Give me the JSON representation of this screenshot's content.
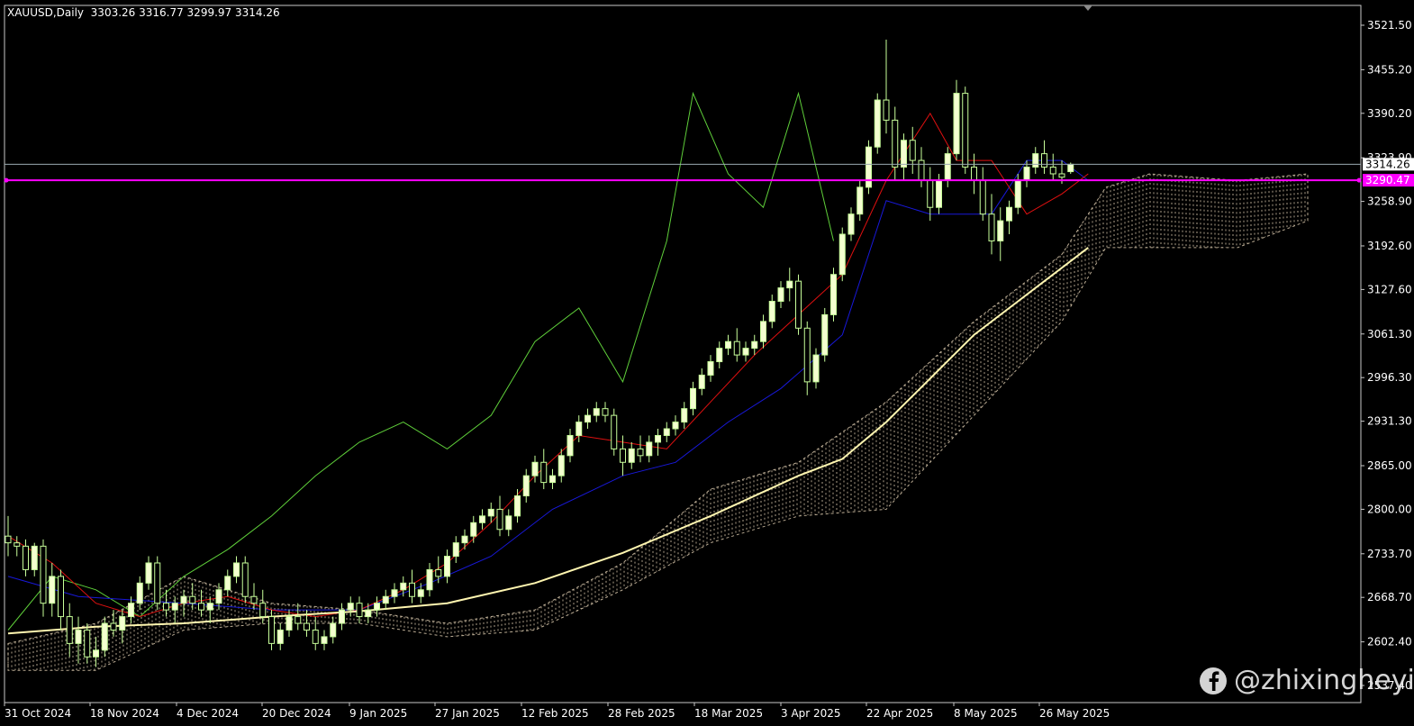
{
  "header": {
    "symbol_timeframe": "XAUUSD,Daily",
    "ohlc": "3303.26 3316.77 3299.97 3314.26"
  },
  "price_labels": {
    "current": "3314.26",
    "horizontal_line": "3290.47"
  },
  "watermark": {
    "icon": "facebook-icon",
    "text": "@zhixingheyi"
  },
  "colors": {
    "background": "#000000",
    "bull_body": "#f4ffd0",
    "wick": "#c8ff9a",
    "tenkan": "#e01010",
    "kijun": "#1818d8",
    "chikou": "#5fcf3a",
    "ma": "#fff6b0",
    "cloud": "#e8d6b8",
    "hline": "#ff00ff"
  },
  "chart_data": {
    "type": "candlestick",
    "symbol": "XAUUSD",
    "timeframe": "Daily",
    "y_ticks": [
      3521.5,
      3455.2,
      3390.2,
      3323.9,
      3258.9,
      3192.6,
      3127.6,
      3061.3,
      2996.3,
      2931.3,
      2865.0,
      2800.0,
      2733.7,
      2668.7,
      2602.4,
      2537.4
    ],
    "x_ticks": [
      "31 Oct 2024",
      "18 Nov 2024",
      "4 Dec 2024",
      "20 Dec 2024",
      "9 Jan 2025",
      "27 Jan 2025",
      "12 Feb 2025",
      "28 Feb 2025",
      "18 Mar 2025",
      "3 Apr 2025",
      "22 Apr 2025",
      "8 May 2025",
      "26 May 2025"
    ],
    "last_ohlc": {
      "open": 3303.26,
      "high": 3316.77,
      "low": 3299.97,
      "close": 3314.26
    },
    "horizontal_line": 3290.47,
    "candles": [
      [
        2760,
        2790,
        2730,
        2750
      ],
      [
        2750,
        2760,
        2730,
        2745
      ],
      [
        2745,
        2755,
        2700,
        2710
      ],
      [
        2710,
        2750,
        2700,
        2745
      ],
      [
        2745,
        2755,
        2640,
        2660
      ],
      [
        2660,
        2720,
        2640,
        2700
      ],
      [
        2700,
        2710,
        2620,
        2640
      ],
      [
        2640,
        2660,
        2580,
        2600
      ],
      [
        2600,
        2640,
        2570,
        2620
      ],
      [
        2620,
        2630,
        2570,
        2580
      ],
      [
        2580,
        2610,
        2565,
        2590
      ],
      [
        2590,
        2640,
        2580,
        2630
      ],
      [
        2630,
        2650,
        2610,
        2620
      ],
      [
        2620,
        2650,
        2600,
        2640
      ],
      [
        2640,
        2670,
        2630,
        2660
      ],
      [
        2660,
        2700,
        2650,
        2690
      ],
      [
        2690,
        2730,
        2680,
        2720
      ],
      [
        2720,
        2730,
        2650,
        2660
      ],
      [
        2660,
        2680,
        2640,
        2650
      ],
      [
        2650,
        2670,
        2630,
        2660
      ],
      [
        2660,
        2680,
        2640,
        2670
      ],
      [
        2670,
        2690,
        2650,
        2660
      ],
      [
        2660,
        2680,
        2640,
        2650
      ],
      [
        2650,
        2670,
        2630,
        2660
      ],
      [
        2660,
        2690,
        2650,
        2680
      ],
      [
        2680,
        2710,
        2670,
        2700
      ],
      [
        2700,
        2730,
        2690,
        2720
      ],
      [
        2720,
        2730,
        2660,
        2670
      ],
      [
        2670,
        2690,
        2650,
        2660
      ],
      [
        2660,
        2680,
        2630,
        2640
      ],
      [
        2640,
        2650,
        2590,
        2600
      ],
      [
        2600,
        2630,
        2590,
        2620
      ],
      [
        2620,
        2650,
        2610,
        2640
      ],
      [
        2640,
        2660,
        2620,
        2630
      ],
      [
        2630,
        2650,
        2610,
        2620
      ],
      [
        2620,
        2640,
        2590,
        2600
      ],
      [
        2600,
        2620,
        2590,
        2610
      ],
      [
        2610,
        2640,
        2600,
        2630
      ],
      [
        2630,
        2660,
        2620,
        2650
      ],
      [
        2650,
        2670,
        2640,
        2660
      ],
      [
        2660,
        2670,
        2630,
        2640
      ],
      [
        2640,
        2660,
        2630,
        2650
      ],
      [
        2650,
        2670,
        2640,
        2660
      ],
      [
        2660,
        2680,
        2650,
        2670
      ],
      [
        2670,
        2690,
        2660,
        2680
      ],
      [
        2680,
        2700,
        2670,
        2690
      ],
      [
        2690,
        2710,
        2660,
        2670
      ],
      [
        2670,
        2690,
        2660,
        2680
      ],
      [
        2680,
        2720,
        2670,
        2710
      ],
      [
        2710,
        2730,
        2690,
        2700
      ],
      [
        2700,
        2740,
        2690,
        2730
      ],
      [
        2730,
        2760,
        2720,
        2750
      ],
      [
        2750,
        2770,
        2740,
        2760
      ],
      [
        2760,
        2790,
        2750,
        2780
      ],
      [
        2780,
        2800,
        2770,
        2790
      ],
      [
        2790,
        2810,
        2780,
        2800
      ],
      [
        2800,
        2820,
        2760,
        2770
      ],
      [
        2770,
        2800,
        2760,
        2790
      ],
      [
        2790,
        2830,
        2780,
        2820
      ],
      [
        2820,
        2860,
        2810,
        2850
      ],
      [
        2850,
        2880,
        2840,
        2870
      ],
      [
        2870,
        2890,
        2830,
        2840
      ],
      [
        2840,
        2860,
        2830,
        2850
      ],
      [
        2850,
        2890,
        2840,
        2880
      ],
      [
        2880,
        2920,
        2870,
        2910
      ],
      [
        2910,
        2940,
        2900,
        2930
      ],
      [
        2930,
        2950,
        2920,
        2940
      ],
      [
        2940,
        2960,
        2930,
        2950
      ],
      [
        2950,
        2960,
        2930,
        2940
      ],
      [
        2940,
        2950,
        2880,
        2890
      ],
      [
        2890,
        2910,
        2850,
        2870
      ],
      [
        2870,
        2900,
        2860,
        2890
      ],
      [
        2890,
        2910,
        2870,
        2880
      ],
      [
        2880,
        2910,
        2870,
        2900
      ],
      [
        2900,
        2920,
        2880,
        2910
      ],
      [
        2910,
        2930,
        2900,
        2920
      ],
      [
        2920,
        2940,
        2910,
        2930
      ],
      [
        2930,
        2960,
        2920,
        2950
      ],
      [
        2950,
        2990,
        2940,
        2980
      ],
      [
        2980,
        3010,
        2970,
        3000
      ],
      [
        3000,
        3030,
        2990,
        3020
      ],
      [
        3020,
        3050,
        3010,
        3040
      ],
      [
        3040,
        3060,
        3030,
        3050
      ],
      [
        3050,
        3070,
        3020,
        3030
      ],
      [
        3030,
        3050,
        3020,
        3040
      ],
      [
        3040,
        3060,
        3030,
        3050
      ],
      [
        3050,
        3090,
        3040,
        3080
      ],
      [
        3080,
        3120,
        3070,
        3110
      ],
      [
        3110,
        3140,
        3100,
        3130
      ],
      [
        3130,
        3160,
        3110,
        3140
      ],
      [
        3140,
        3150,
        3060,
        3070
      ],
      [
        3070,
        3080,
        2970,
        2990
      ],
      [
        2990,
        3040,
        2980,
        3030
      ],
      [
        3030,
        3100,
        3020,
        3090
      ],
      [
        3090,
        3160,
        3080,
        3150
      ],
      [
        3150,
        3220,
        3140,
        3210
      ],
      [
        3210,
        3250,
        3200,
        3240
      ],
      [
        3240,
        3290,
        3230,
        3280
      ],
      [
        3280,
        3350,
        3270,
        3340
      ],
      [
        3340,
        3420,
        3330,
        3410
      ],
      [
        3410,
        3500,
        3360,
        3380
      ],
      [
        3380,
        3400,
        3290,
        3310
      ],
      [
        3310,
        3360,
        3290,
        3350
      ],
      [
        3350,
        3370,
        3300,
        3320
      ],
      [
        3320,
        3340,
        3280,
        3290
      ],
      [
        3290,
        3310,
        3230,
        3250
      ],
      [
        3250,
        3300,
        3240,
        3290
      ],
      [
        3290,
        3340,
        3280,
        3330
      ],
      [
        3330,
        3440,
        3320,
        3420
      ],
      [
        3420,
        3430,
        3300,
        3310
      ],
      [
        3310,
        3330,
        3270,
        3290
      ],
      [
        3290,
        3310,
        3230,
        3240
      ],
      [
        3240,
        3270,
        3180,
        3200
      ],
      [
        3200,
        3250,
        3170,
        3230
      ],
      [
        3230,
        3260,
        3210,
        3250
      ],
      [
        3250,
        3300,
        3240,
        3290
      ],
      [
        3290,
        3320,
        3280,
        3310
      ],
      [
        3310,
        3340,
        3300,
        3330
      ],
      [
        3330,
        3350,
        3300,
        3310
      ],
      [
        3310,
        3330,
        3290,
        3300
      ],
      [
        3300,
        3320,
        3285,
        3295
      ],
      [
        3303.26,
        3316.77,
        3299.97,
        3314.26
      ]
    ],
    "ma": [
      [
        0,
        2615
      ],
      [
        10,
        2625
      ],
      [
        20,
        2630
      ],
      [
        30,
        2640
      ],
      [
        40,
        2648
      ],
      [
        50,
        2660
      ],
      [
        60,
        2690
      ],
      [
        70,
        2735
      ],
      [
        80,
        2790
      ],
      [
        90,
        2850
      ],
      [
        95,
        2875
      ],
      [
        100,
        2930
      ],
      [
        105,
        2995
      ],
      [
        110,
        3060
      ],
      [
        115,
        3110
      ],
      [
        120,
        3160
      ],
      [
        123,
        3190
      ]
    ],
    "tenkan": [
      [
        0,
        2760
      ],
      [
        5,
        2720
      ],
      [
        10,
        2660
      ],
      [
        15,
        2640
      ],
      [
        20,
        2660
      ],
      [
        25,
        2670
      ],
      [
        30,
        2650
      ],
      [
        35,
        2640
      ],
      [
        40,
        2650
      ],
      [
        45,
        2680
      ],
      [
        50,
        2720
      ],
      [
        55,
        2780
      ],
      [
        60,
        2850
      ],
      [
        65,
        2910
      ],
      [
        70,
        2900
      ],
      [
        75,
        2890
      ],
      [
        80,
        2960
      ],
      [
        85,
        3030
      ],
      [
        90,
        3090
      ],
      [
        95,
        3150
      ],
      [
        100,
        3290
      ],
      [
        105,
        3390
      ],
      [
        108,
        3320
      ],
      [
        112,
        3320
      ],
      [
        116,
        3240
      ],
      [
        120,
        3270
      ],
      [
        123,
        3300
      ]
    ],
    "kijun": [
      [
        0,
        2700
      ],
      [
        8,
        2670
      ],
      [
        20,
        2660
      ],
      [
        30,
        2650
      ],
      [
        40,
        2650
      ],
      [
        48,
        2690
      ],
      [
        55,
        2730
      ],
      [
        62,
        2800
      ],
      [
        70,
        2850
      ],
      [
        76,
        2870
      ],
      [
        82,
        2930
      ],
      [
        88,
        2980
      ],
      [
        95,
        3060
      ],
      [
        100,
        3260
      ],
      [
        105,
        3240
      ],
      [
        112,
        3240
      ],
      [
        116,
        3320
      ],
      [
        120,
        3320
      ],
      [
        123,
        3290
      ]
    ],
    "chikou": [
      [
        0,
        2620
      ],
      [
        5,
        2700
      ],
      [
        10,
        2680
      ],
      [
        15,
        2640
      ],
      [
        20,
        2700
      ],
      [
        25,
        2740
      ],
      [
        30,
        2790
      ],
      [
        35,
        2850
      ],
      [
        40,
        2900
      ],
      [
        45,
        2930
      ],
      [
        50,
        2890
      ],
      [
        55,
        2940
      ],
      [
        60,
        3050
      ],
      [
        65,
        3100
      ],
      [
        70,
        2990
      ],
      [
        75,
        3200
      ],
      [
        78,
        3420
      ],
      [
        82,
        3300
      ],
      [
        86,
        3250
      ],
      [
        90,
        3420
      ],
      [
        94,
        3200
      ]
    ],
    "cloud": [
      [
        0,
        2600,
        2560
      ],
      [
        10,
        2630,
        2560
      ],
      [
        20,
        2700,
        2620
      ],
      [
        30,
        2660,
        2630
      ],
      [
        40,
        2650,
        2630
      ],
      [
        50,
        2630,
        2610
      ],
      [
        60,
        2650,
        2620
      ],
      [
        70,
        2720,
        2680
      ],
      [
        80,
        2830,
        2750
      ],
      [
        90,
        2870,
        2790
      ],
      [
        100,
        2960,
        2800
      ],
      [
        110,
        3080,
        2940
      ],
      [
        120,
        3180,
        3080
      ],
      [
        125,
        3280,
        3190
      ],
      [
        130,
        3300,
        3190
      ],
      [
        140,
        3290,
        3190
      ],
      [
        148,
        3300,
        3230
      ]
    ]
  }
}
